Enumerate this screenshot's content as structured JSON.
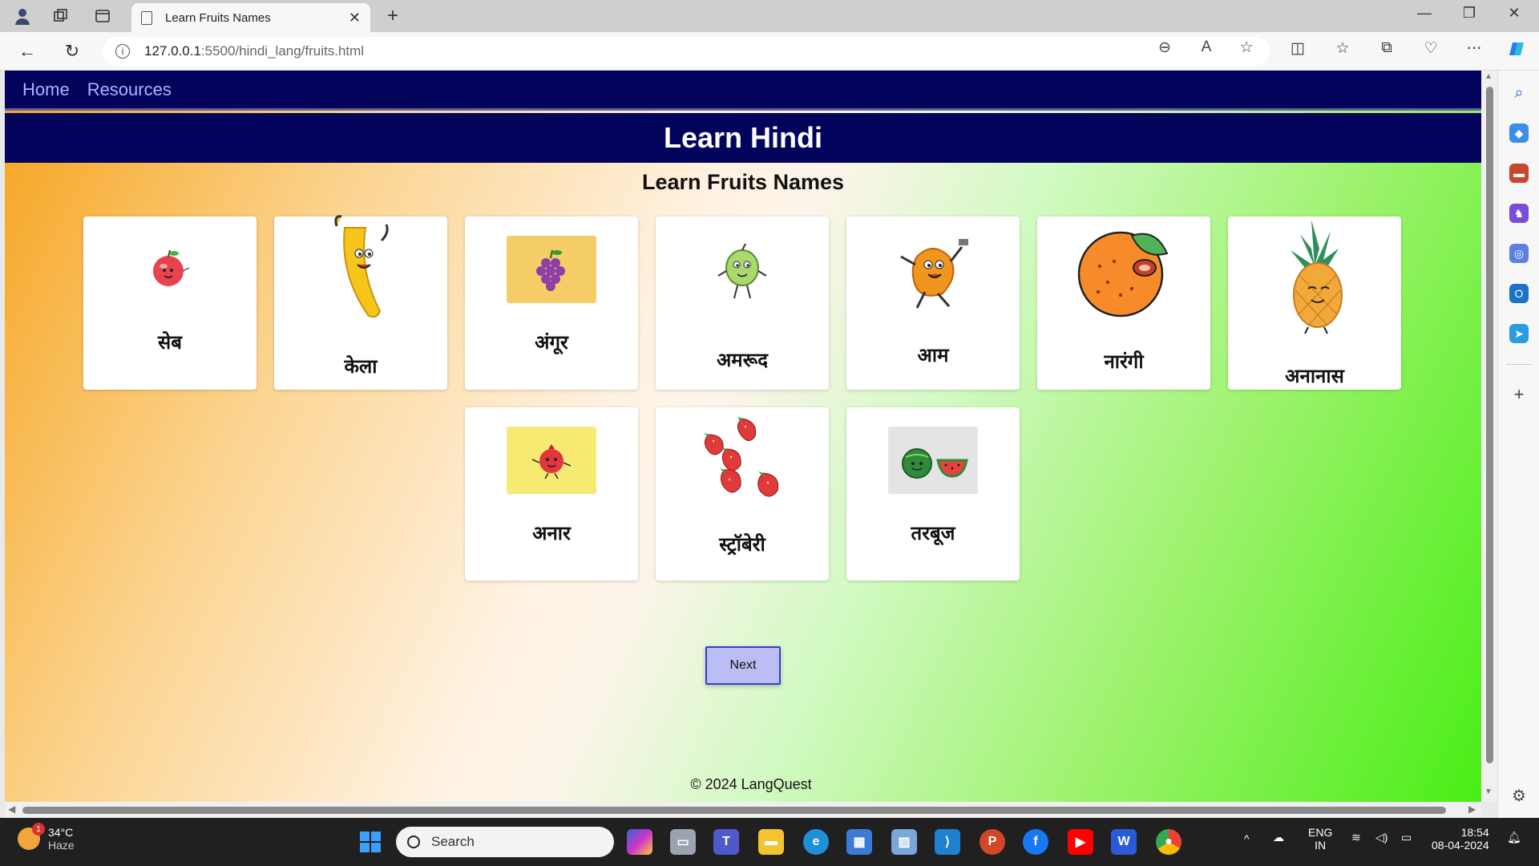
{
  "browser": {
    "tab_title": "Learn Fruits Names",
    "url_host": "127.0.0.1",
    "url_rest": ":5500/hindi_lang/fruits.html"
  },
  "page": {
    "nav": [
      "Home",
      "Resources"
    ],
    "hero_title": "Learn Hindi",
    "subtitle": "Learn Fruits Names",
    "fruits": [
      {
        "name": "सेब",
        "icon": "apple-icon"
      },
      {
        "name": "केला",
        "icon": "banana-icon"
      },
      {
        "name": "अंगूर",
        "icon": "grapes-icon"
      },
      {
        "name": "अमरूद",
        "icon": "guava-icon"
      },
      {
        "name": "आम",
        "icon": "mango-icon"
      },
      {
        "name": "नारंगी",
        "icon": "orange-icon"
      },
      {
        "name": "अनानास",
        "icon": "pineapple-icon"
      },
      {
        "name": "अनार",
        "icon": "pomegranate-icon"
      },
      {
        "name": "स्ट्रॉबेरी",
        "icon": "strawberry-icon"
      },
      {
        "name": "तरबूज",
        "icon": "watermelon-icon"
      }
    ],
    "next_label": "Next",
    "footer": "© 2024 LangQuest"
  },
  "taskbar": {
    "weather_temp": "34°C",
    "weather_desc": "Haze",
    "weather_badge": "1",
    "search_label": "Search",
    "lang_1": "ENG",
    "lang_2": "IN",
    "time": "18:54",
    "date": "08-04-2024"
  },
  "colors": {
    "nav_bg": "#03035c",
    "nav_link": "#a9b3ff",
    "button_bg": "#bdbdf6",
    "button_border": "#3b3bd1"
  }
}
